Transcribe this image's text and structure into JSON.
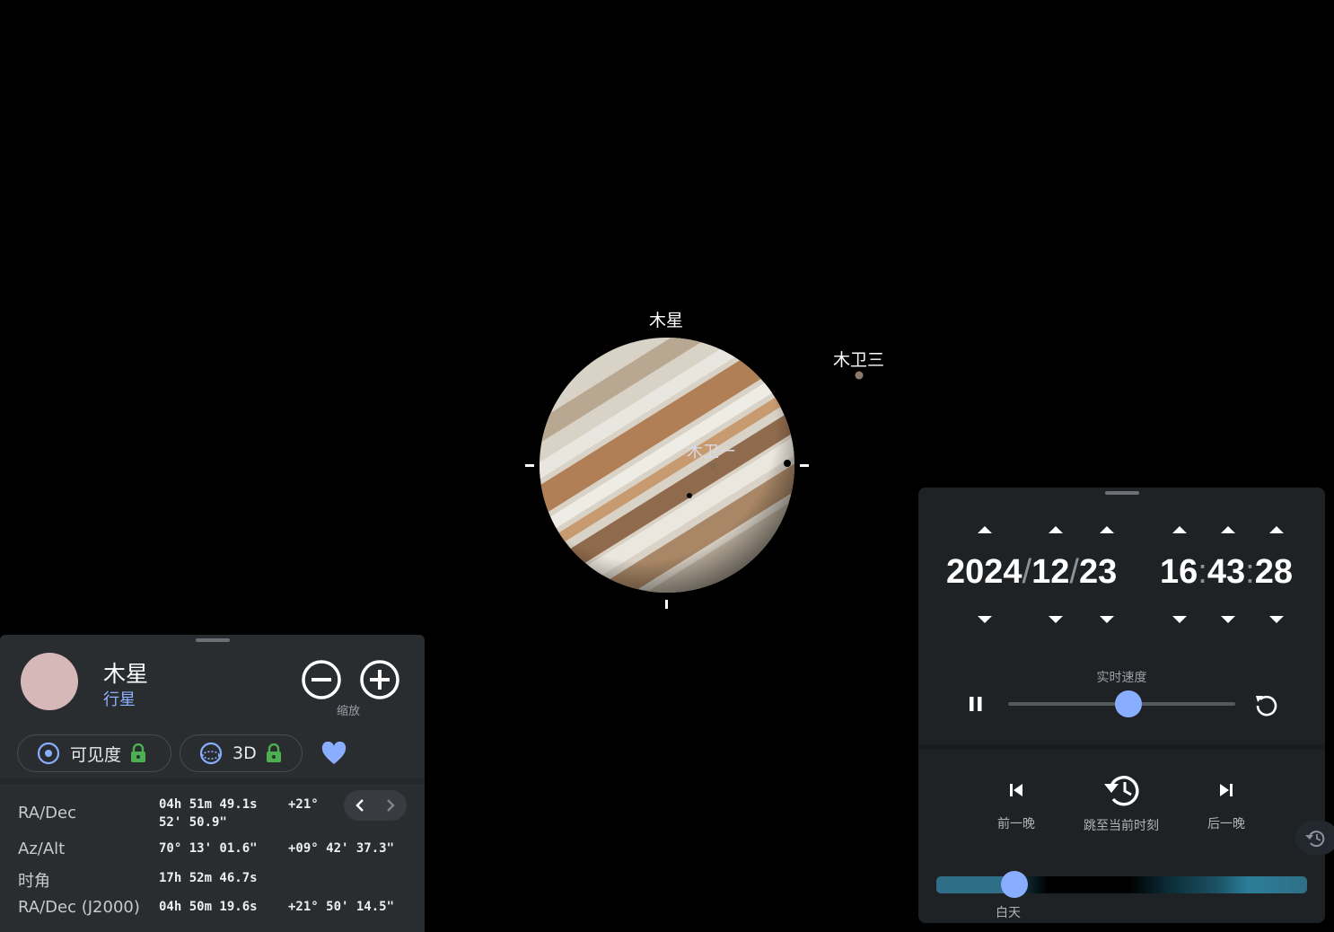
{
  "sky": {
    "planet_label": "木星",
    "moon_labels": {
      "ganymede": "木卫三",
      "io": "木卫一"
    }
  },
  "info_panel": {
    "name": "木星",
    "type": "行星",
    "zoom_label": "缩放",
    "chips": [
      {
        "label": "可见度",
        "icon": "visibility-target-icon",
        "locked": true
      },
      {
        "label": "3D",
        "icon": "3d-orbit-icon",
        "locked": true
      }
    ],
    "favorite_icon": "heart-icon",
    "rows": [
      {
        "label": "RA/Dec",
        "v1": "04h  51m 49.1s",
        "v2": "+21°",
        "v3": "52' 50.9\""
      },
      {
        "label": "Az/Alt",
        "v1": "70°  13' 01.6\"",
        "v2": "+09° 42' 37.3\""
      },
      {
        "label": "时角",
        "v1": "17h  52m 46.7s"
      },
      {
        "label": "RA/Dec (J2000)",
        "v1": "04h  50m 19.6s",
        "v2": "+21° 50' 14.5\""
      }
    ]
  },
  "time_panel": {
    "year": "2024",
    "month": "12",
    "day": "23",
    "hour": "16",
    "minute": "43",
    "second": "28",
    "date_sep": "/",
    "time_sep": ":",
    "speed_label": "实时速度",
    "speed_level": 0.53,
    "prev_night": "前一晚",
    "jump_now": "跳至当前时刻",
    "next_night": "后一晚",
    "daylight_label": "白天",
    "daylight_position": 0.21,
    "colors": {
      "accent": "#8aaeff",
      "panel": "#1f2225"
    }
  }
}
